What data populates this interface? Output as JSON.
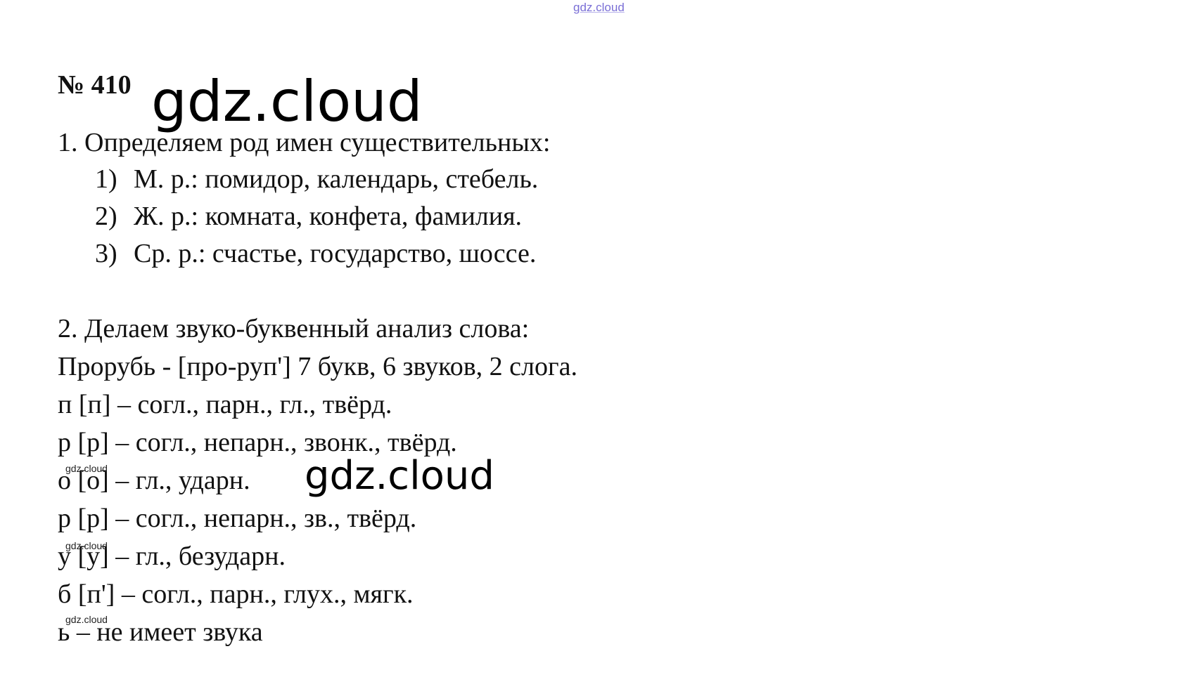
{
  "watermark": "gdz.cloud",
  "title": "№ 410",
  "section1": {
    "heading": "1. Определяем род имен существительных:",
    "items": [
      {
        "num": "1)",
        "text": "М. р.: помидор, календарь, стебель."
      },
      {
        "num": "2)",
        "text": "Ж. р.: комната, конфета, фамилия."
      },
      {
        "num": "3)",
        "text": "Ср. р.: счастье, государство, шоссе."
      }
    ]
  },
  "section2": {
    "heading": "2. Делаем звуко-буквенный анализ слова:",
    "word_line": "Прорубь - [про-руп'] 7 букв, 6 звуков, 2 слога.",
    "letters": [
      "п [п] – согл., парн., гл., твёрд.",
      "р [р] – согл., непарн., звонк., твёрд.",
      "о [о] – гл., ударн.",
      "р [р] – согл., непарн., зв., твёрд.",
      "у [у] – гл., безударн.",
      "б [п'] – согл., парн., глух., мягк.",
      "ь – не имеет звука"
    ]
  }
}
